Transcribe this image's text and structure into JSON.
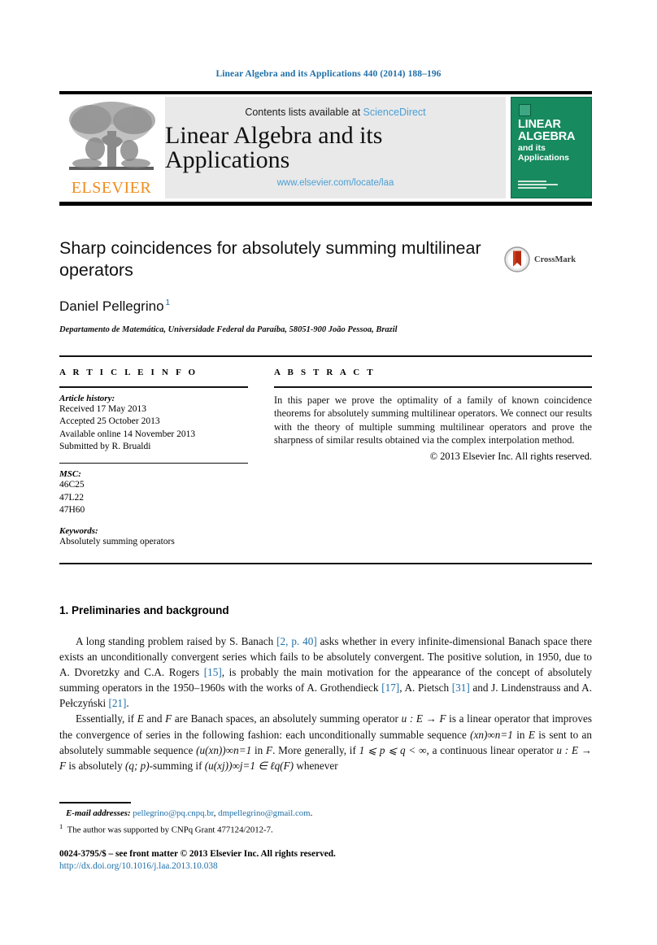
{
  "running_head": "Linear Algebra and its Applications 440 (2014) 188–196",
  "masthead": {
    "contents_prefix": "Contents lists available at ",
    "sciencedirect": "ScienceDirect",
    "journal_title": "Linear Algebra and its Applications",
    "journal_url": "www.elsevier.com/locate/laa",
    "publisher_word": "ELSEVIER",
    "publisher_logo_icon": "elsevier-tree-icon",
    "cover": {
      "line1": "LINEAR",
      "line2": "ALGEBRA",
      "line3": "and its",
      "line4": "Applications",
      "background_color": "#178a5f"
    }
  },
  "article": {
    "title": "Sharp coincidences for absolutely summing multilinear operators",
    "author": "Daniel Pellegrino",
    "author_footnote_marker": "1",
    "affiliation": "Departamento de Matemática, Universidade Federal da Paraíba, 58051-900 João Pessoa, Brazil",
    "crossmark_label": "CrossMark",
    "crossmark_icon": "crossmark-icon"
  },
  "info": {
    "heading": "A R T I C L E   I N F O",
    "history_label": "Article history:",
    "history": [
      "Received 17 May 2013",
      "Accepted 25 October 2013",
      "Available online 14 November 2013",
      "Submitted by R. Brualdi"
    ],
    "msc_label": "MSC:",
    "msc": [
      "46C25",
      "47L22",
      "47H60"
    ],
    "keywords_label": "Keywords:",
    "keywords": [
      "Absolutely summing operators"
    ]
  },
  "abstract": {
    "heading": "A B S T R A C T",
    "text": "In this paper we prove the optimality of a family of known coincidence theorems for absolutely summing multilinear operators. We connect our results with the theory of multiple summing multilinear operators and prove the sharpness of similar results obtained via the complex interpolation method.",
    "copyright": "© 2013 Elsevier Inc. All rights reserved."
  },
  "body": {
    "section_title": "1. Preliminaries and background",
    "paragraph1_parts": {
      "a": "A long standing problem raised by S. Banach ",
      "ref1": "[2, p. 40]",
      "b": " asks whether in every infinite-dimensional Banach space there exists an unconditionally convergent series which fails to be absolutely convergent. The positive solution, in 1950, due to A. Dvoretzky and C.A. Rogers ",
      "ref2": "[15]",
      "c": ", is probably the main motivation for the appearance of the concept of absolutely summing operators in the 1950–1960s with the works of A. Grothendieck ",
      "ref3": "[17]",
      "d": ", A. Pietsch ",
      "ref4": "[31]",
      "e": " and J. Lindenstrauss and A. Pełczyński ",
      "ref5": "[21]",
      "f": "."
    },
    "paragraph2_parts": {
      "a": "Essentially, if ",
      "v1": "E",
      "b": " and ",
      "v2": "F",
      "c": " are Banach spaces, an absolutely summing operator ",
      "v3": "u : E → F",
      "d": " is a linear operator that improves the convergence of series in the following fashion: each unconditionally summable sequence ",
      "m1": "(xn)∞n=1",
      "e": " in ",
      "v4": "E",
      "f": " is sent to an absolutely summable sequence ",
      "m2": "(u(xn))∞n=1",
      "g": " in ",
      "v5": "F",
      "h": ". More generally, if ",
      "m3": "1 ⩽ p ⩽ q < ∞",
      "i": ", a continuous linear operator ",
      "v6": "u : E → F",
      "j": " is absolutely ",
      "m4": "(q; p)",
      "k": "-summing if ",
      "m5": "(u(xj))∞j=1 ∈ ℓq(F)",
      "l": " whenever"
    }
  },
  "footnotes": {
    "email_label": "E-mail addresses:",
    "emails": [
      "pellegrino@pq.cnpq.br",
      "dmpellegrino@gmail.com"
    ],
    "email_suffix": ".",
    "note_marker": "1",
    "note_text": "The author was supported by CNPq Grant 477124/2012-7."
  },
  "colophon": {
    "front_matter": "0024-3795/$ – see front matter © 2013 Elsevier Inc. All rights reserved.",
    "doi": "http://dx.doi.org/10.1016/j.laa.2013.10.038"
  },
  "colors": {
    "link": "#1f6fa8",
    "sciencedirect": "#4b9fd5",
    "elsevier_orange": "#f08c1b",
    "cover_green": "#178a5f"
  }
}
